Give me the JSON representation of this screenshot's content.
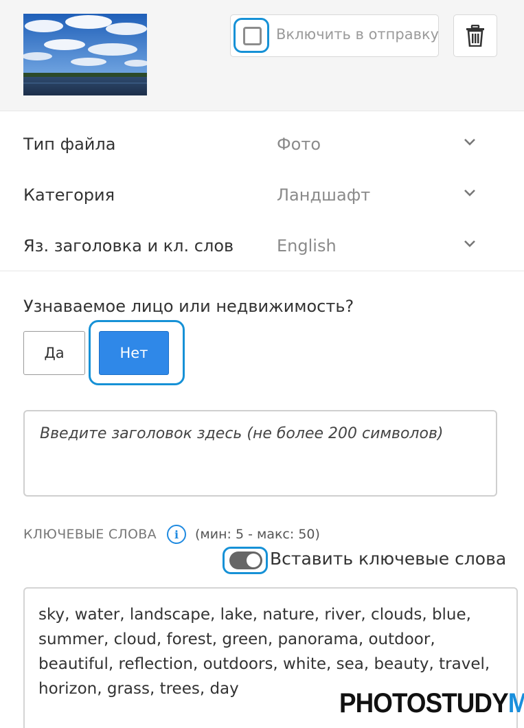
{
  "header": {
    "include_label": "Включить в отправку",
    "include_checked": false
  },
  "fields": [
    {
      "label": "Тип файла",
      "value": "Фото"
    },
    {
      "label": "Категория",
      "value": "Ландшафт"
    },
    {
      "label": "Яз. заголовка и кл. слов",
      "value": "English"
    }
  ],
  "recognizable": {
    "question": "Узнаваемое лицо или недвижимость?",
    "yes_label": "Да",
    "no_label": "Нет",
    "selected": "Нет"
  },
  "title_input": {
    "placeholder": "Введите заголовок здесь (не более 200 символов)"
  },
  "keywords": {
    "label": "КЛЮЧЕВЫЕ СЛОВА",
    "range": "(мин: 5 - макс: 50)",
    "paste_label": "Вставить ключевые слова",
    "paste_enabled": true,
    "text": "sky, water, landscape, lake, nature, river, clouds, blue, summer, cloud, forest, green, panorama, outdoor, beautiful, reflection, outdoors, white, sea, beauty, travel, horizon, grass, trees, day"
  },
  "watermark": {
    "part1": "PHOTOSTUDY",
    "part2": "ME"
  },
  "colors": {
    "accent": "#2f88e8",
    "highlight": "#1691d6"
  }
}
